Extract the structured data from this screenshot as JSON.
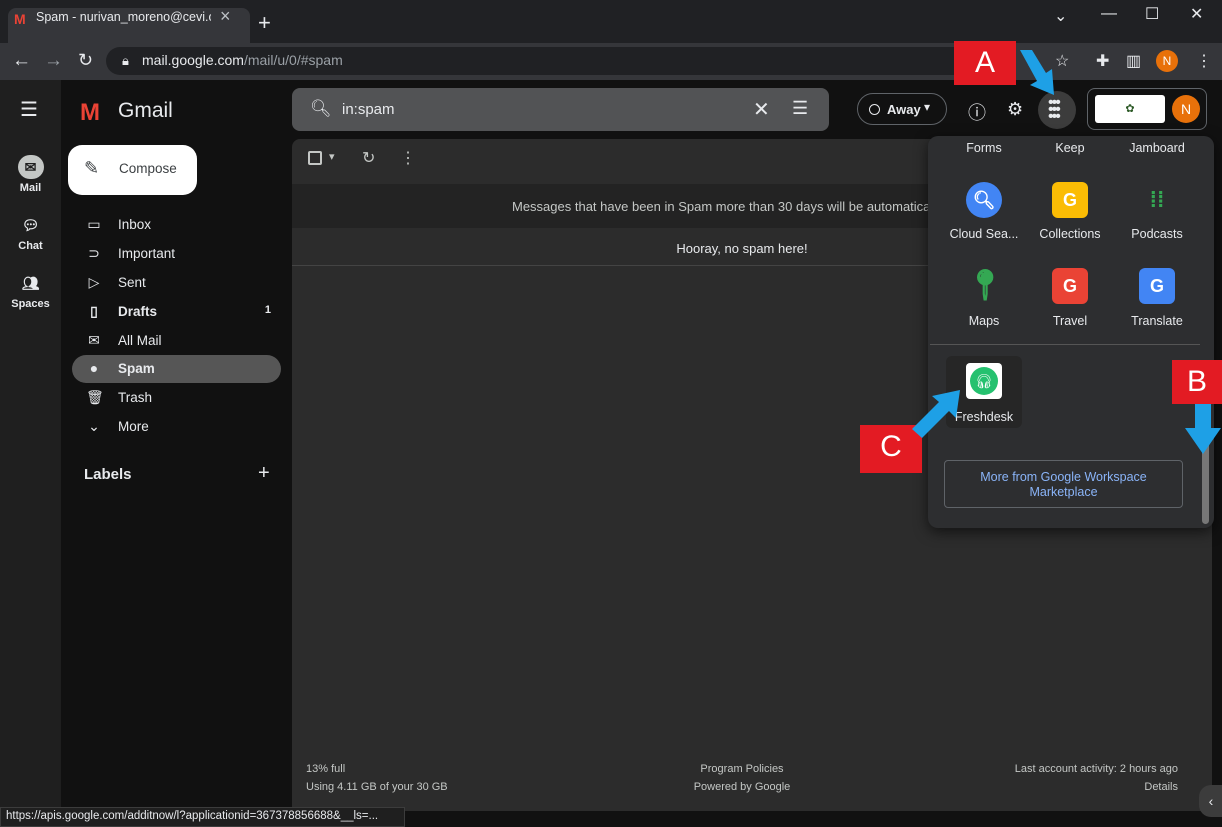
{
  "browser": {
    "tab_title": "Spam - nurivan_moreno@cevi.org",
    "tab_favicon": "gmail-icon",
    "url_host": "mail.google.com",
    "url_path": "/mail/u/0/#spam",
    "profile_initial": "N",
    "status_url": "https://apis.google.com/additnow/l?applicationid=367378856688&__ls=..."
  },
  "rail": {
    "items": [
      {
        "label": "Mail",
        "icon": "mail-icon"
      },
      {
        "label": "Chat",
        "icon": "chat-icon"
      },
      {
        "label": "Spaces",
        "icon": "spaces-icon"
      }
    ]
  },
  "app": {
    "name": "Gmail",
    "compose_label": "Compose"
  },
  "sidebar": {
    "items": [
      {
        "label": "Inbox",
        "icon": "inbox-icon",
        "count": ""
      },
      {
        "label": "Important",
        "icon": "important-icon",
        "count": ""
      },
      {
        "label": "Sent",
        "icon": "sent-icon",
        "count": ""
      },
      {
        "label": "Drafts",
        "icon": "drafts-icon",
        "count": "1"
      },
      {
        "label": "All Mail",
        "icon": "all-mail-icon",
        "count": ""
      },
      {
        "label": "Spam",
        "icon": "spam-icon",
        "count": ""
      },
      {
        "label": "Trash",
        "icon": "trash-icon",
        "count": ""
      },
      {
        "label": "More",
        "icon": "chevron-down-icon",
        "count": ""
      }
    ],
    "labels_title": "Labels"
  },
  "search": {
    "value": "in:spam"
  },
  "status": {
    "label": "Away"
  },
  "main": {
    "spam_banner": "Messages that have been in Spam more than 30 days will be automatical",
    "empty_message": "Hooray, no spam here!"
  },
  "footer": {
    "storage_percent": "13% full",
    "storage_detail": "Using 4.11 GB of your 30 GB",
    "program_policies": "Program Policies",
    "powered_by": "Powered by Google",
    "last_activity": "Last account activity: 2 hours ago",
    "details": "Details"
  },
  "apps_panel": {
    "top_row": [
      "Forms",
      "Keep",
      "Jamboard"
    ],
    "grid": [
      {
        "label": "Cloud Sea...",
        "icon": "cloud-search-icon",
        "color": "#4285f4"
      },
      {
        "label": "Collections",
        "icon": "collections-icon",
        "color": "#fbbc04"
      },
      {
        "label": "Podcasts",
        "icon": "podcasts-icon",
        "color": "#34a853"
      },
      {
        "label": "Maps",
        "icon": "maps-icon",
        "color": "#34a853"
      },
      {
        "label": "Travel",
        "icon": "travel-icon",
        "color": "#ea4335"
      },
      {
        "label": "Translate",
        "icon": "translate-icon",
        "color": "#4285f4"
      }
    ],
    "freshdesk_label": "Freshdesk",
    "marketplace_label": "More from Google Workspace Marketplace"
  },
  "annotations": {
    "a": "A",
    "b": "B",
    "c": "C",
    "color": "#e31b23",
    "arrow_color": "#1ea0e6"
  }
}
